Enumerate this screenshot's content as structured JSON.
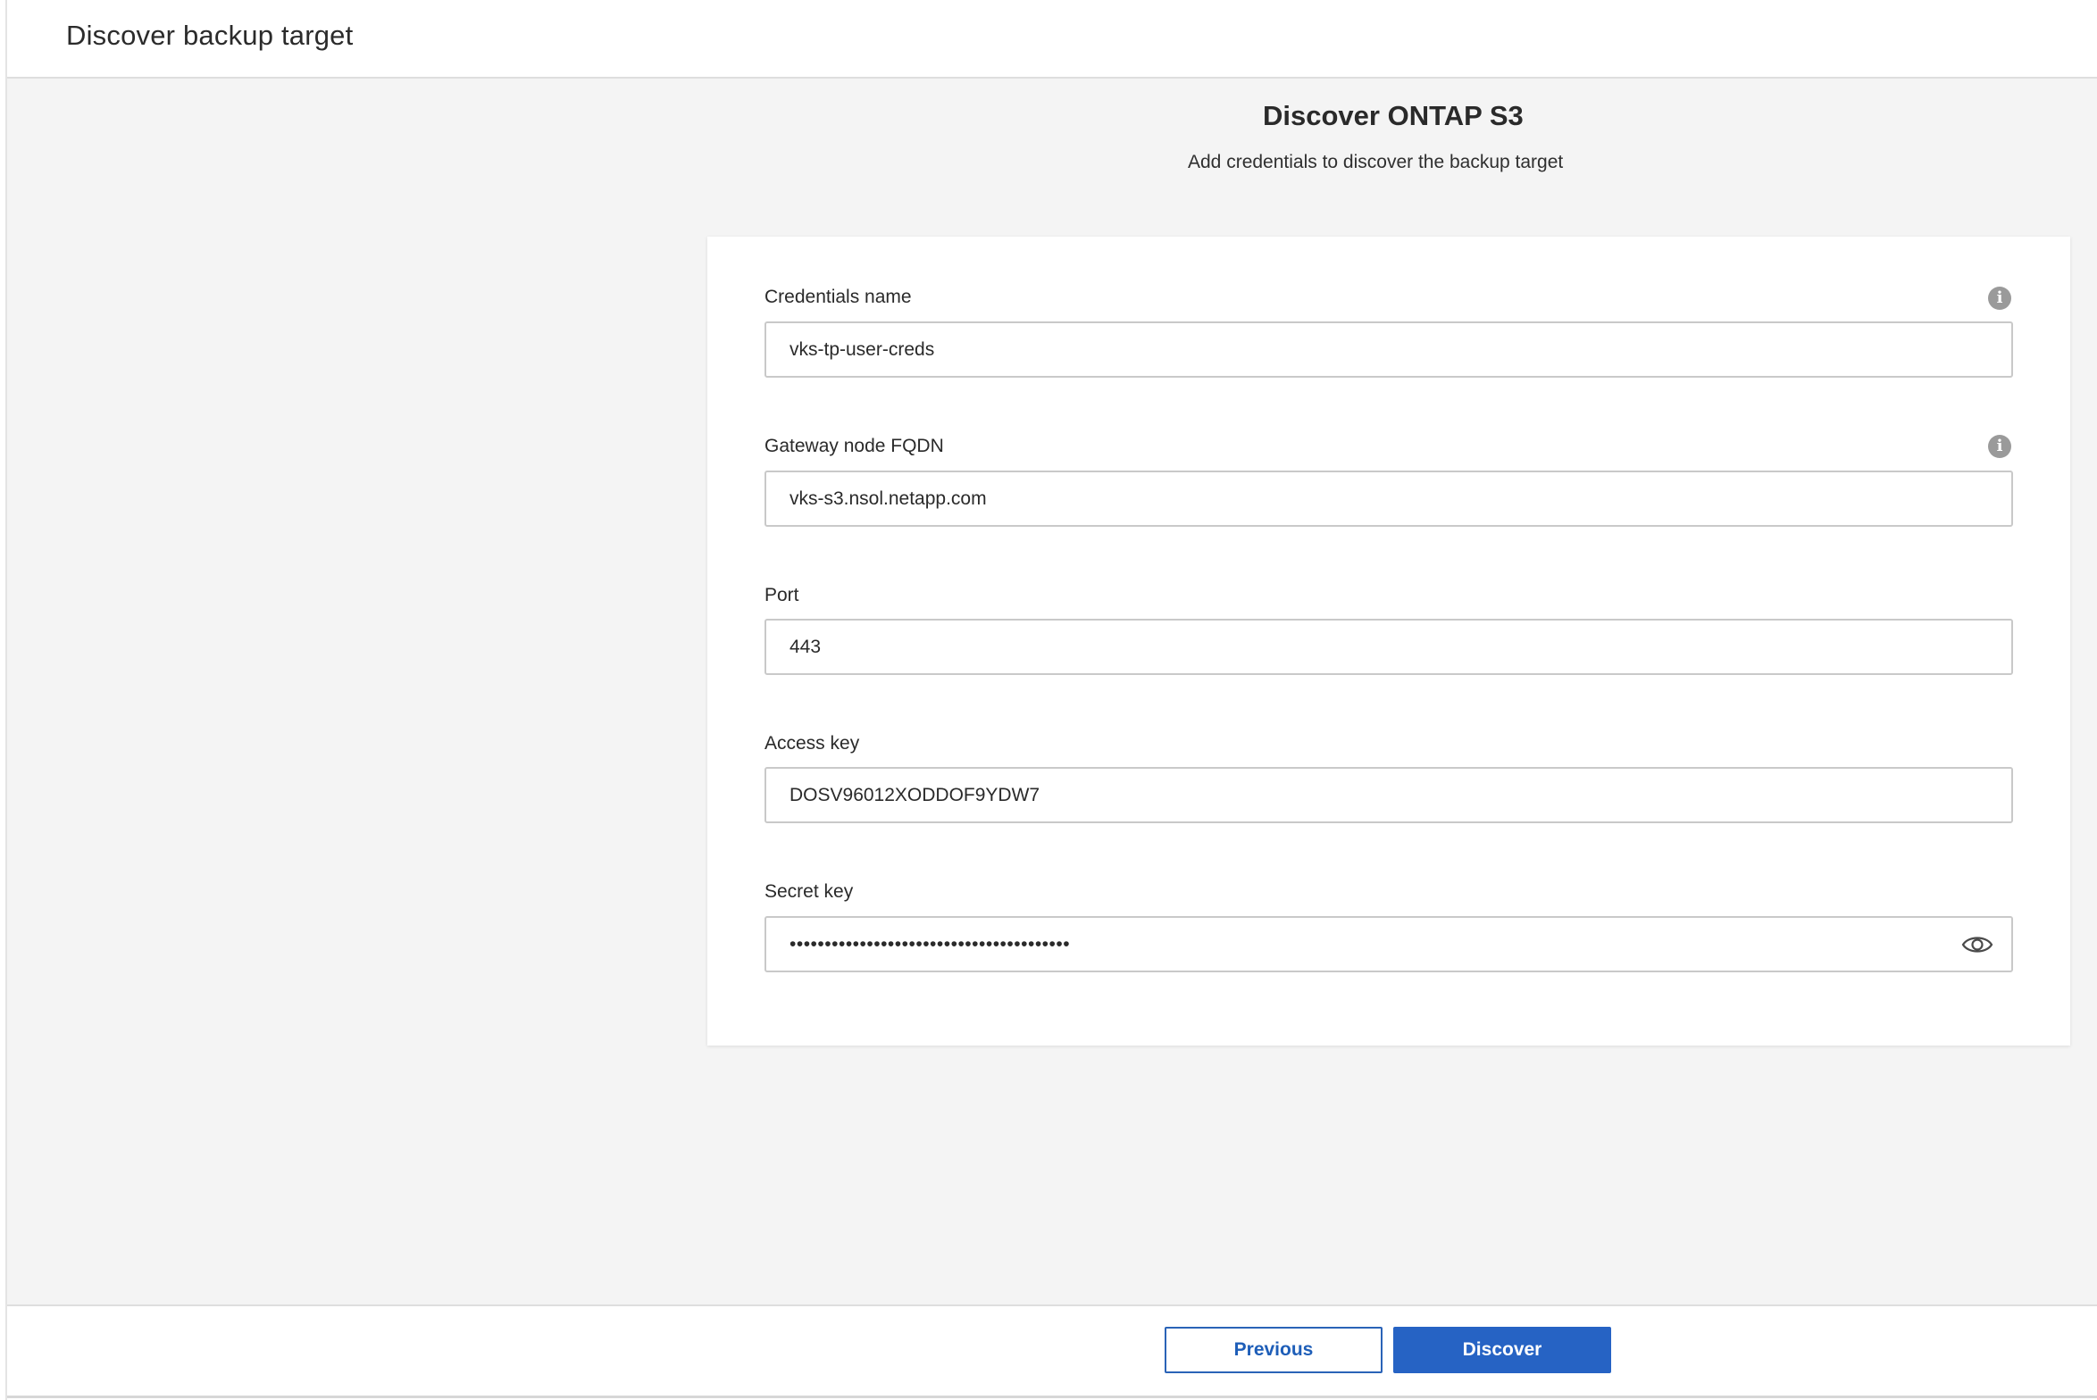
{
  "header": {
    "title": "Discover backup target"
  },
  "main": {
    "title": "Discover ONTAP S3",
    "subtitle": "Add credentials to discover the backup target"
  },
  "form": {
    "credentials_name": {
      "label": "Credentials name",
      "value": "vks-tp-user-creds",
      "info_icon": "info-icon"
    },
    "gateway_fqdn": {
      "label": "Gateway node FQDN",
      "value": "vks-s3.nsol.netapp.com",
      "info_icon": "info-icon"
    },
    "port": {
      "label": "Port",
      "value": "443"
    },
    "access_key": {
      "label": "Access key",
      "value": "DOSV96012XODDOF9YDW7"
    },
    "secret_key": {
      "label": "Secret key",
      "masked_value": "••••••••••••••••••••••••••••••••••••••••",
      "toggle_icon": "eye-icon"
    }
  },
  "footer": {
    "previous_label": "Previous",
    "discover_label": "Discover"
  },
  "colors": {
    "primary": "#2663c4",
    "background": "#f4f4f4",
    "card": "#ffffff",
    "info_icon": "#9a9a9a"
  }
}
